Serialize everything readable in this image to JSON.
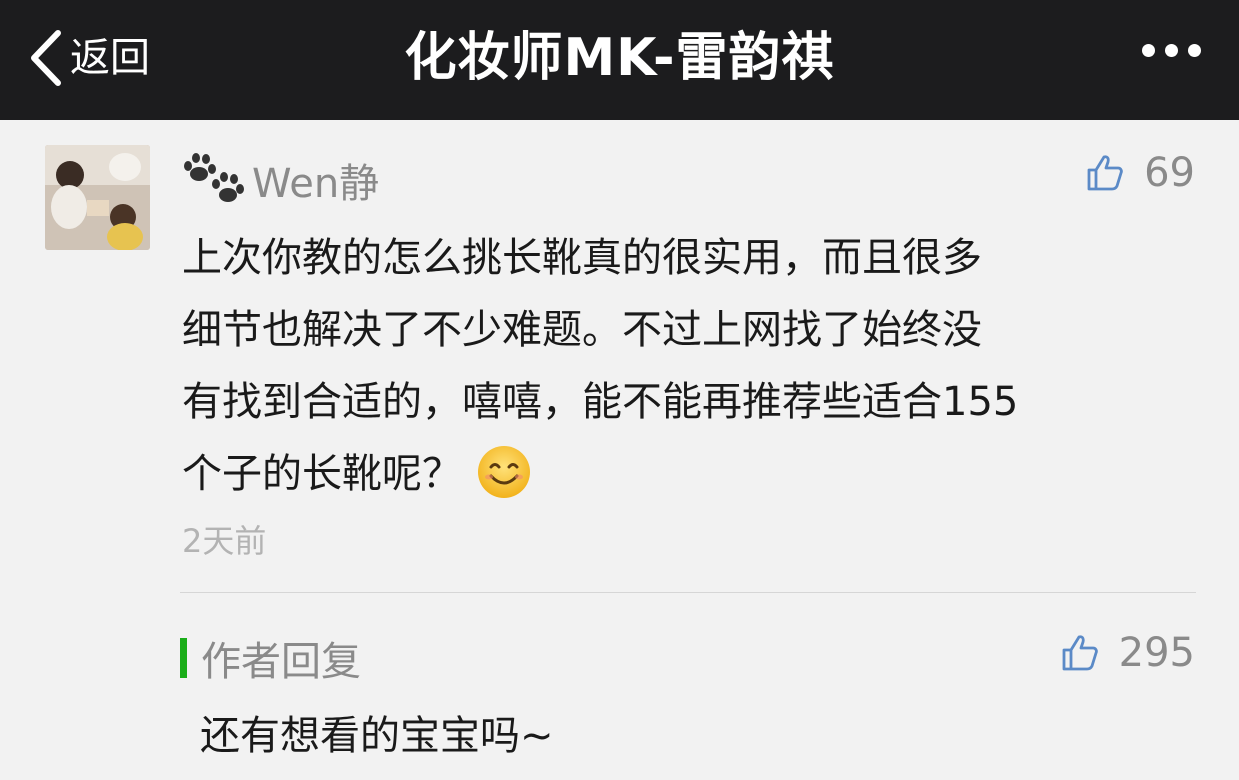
{
  "navbar": {
    "back_label": "返回",
    "title": "化妆师MK-雷韵祺"
  },
  "comment": {
    "username": "Wen静",
    "likes": "69",
    "lines": [
      "上次你教的怎么挑长靴真的很实用，而且很多",
      "细节也解决了不少难题。不过上网找了始终没",
      "有找到合适的，嘻嘻，能不能再推荐些适合155",
      "个子的长靴呢？"
    ],
    "time": "2天前"
  },
  "reply": {
    "author_label": "作者回复",
    "likes": "295",
    "text": "还有想看的宝宝吗~"
  },
  "colors": {
    "navbar_bg": "#1c1c1e",
    "page_bg": "#f2f2f2",
    "like_icon": "#5b8ac7",
    "reply_bar": "#1aad19"
  }
}
